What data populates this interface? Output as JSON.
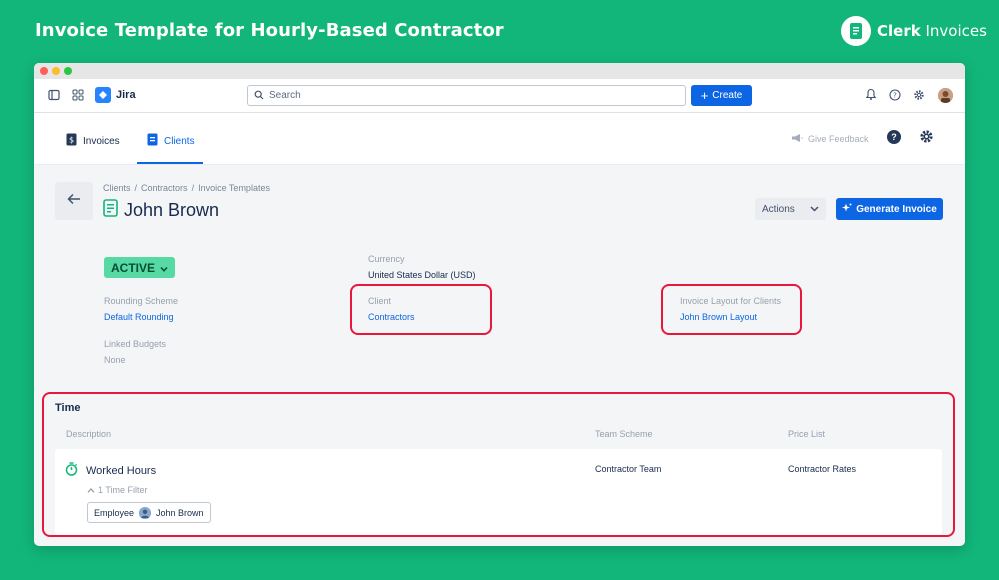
{
  "banner": {
    "title": "Invoice Template for Hourly-Based Contractor",
    "brand_bold": "Clerk",
    "brand_rest": " Invoices"
  },
  "topnav": {
    "app_name": "Jira",
    "search_placeholder": "Search",
    "create_label": "Create"
  },
  "subnav": {
    "tabs": [
      {
        "label": "Invoices",
        "icon": "invoice-icon"
      },
      {
        "label": "Clients",
        "icon": "clients-icon"
      }
    ],
    "active_tab": "Clients",
    "feedback_label": "Give Feedback",
    "help_glyph": "?"
  },
  "page": {
    "breadcrumb": [
      "Clients",
      "Contractors",
      "Invoice Templates"
    ],
    "breadcrumb_sep": "/",
    "title": "John Brown",
    "actions_label": "Actions",
    "generate_label": "Generate Invoice"
  },
  "details": {
    "status": "ACTIVE",
    "currency_label": "Currency",
    "currency_value": "United States Dollar (USD)",
    "rounding_label": "Rounding Scheme",
    "rounding_value": "Default Rounding",
    "client_label": "Client",
    "client_value": "Contractors",
    "layout_label": "Invoice Layout for Clients",
    "layout_value": "John Brown Layout",
    "budgets_label": "Linked Budgets",
    "budgets_value": "None"
  },
  "time": {
    "section_title": "Time",
    "columns": [
      "Description",
      "Team Scheme",
      "Price List"
    ],
    "row": {
      "name": "Worked Hours",
      "filter_toggle": "1 Time Filter",
      "chip_label": "Employee",
      "chip_value": "John Brown",
      "team_scheme": "Contractor Team",
      "price_list": "Contractor Rates"
    }
  },
  "colors": {
    "background": "#12b67a",
    "accent": "#0c66e4",
    "highlight": "#e8173c",
    "status": "#57d9a3"
  }
}
